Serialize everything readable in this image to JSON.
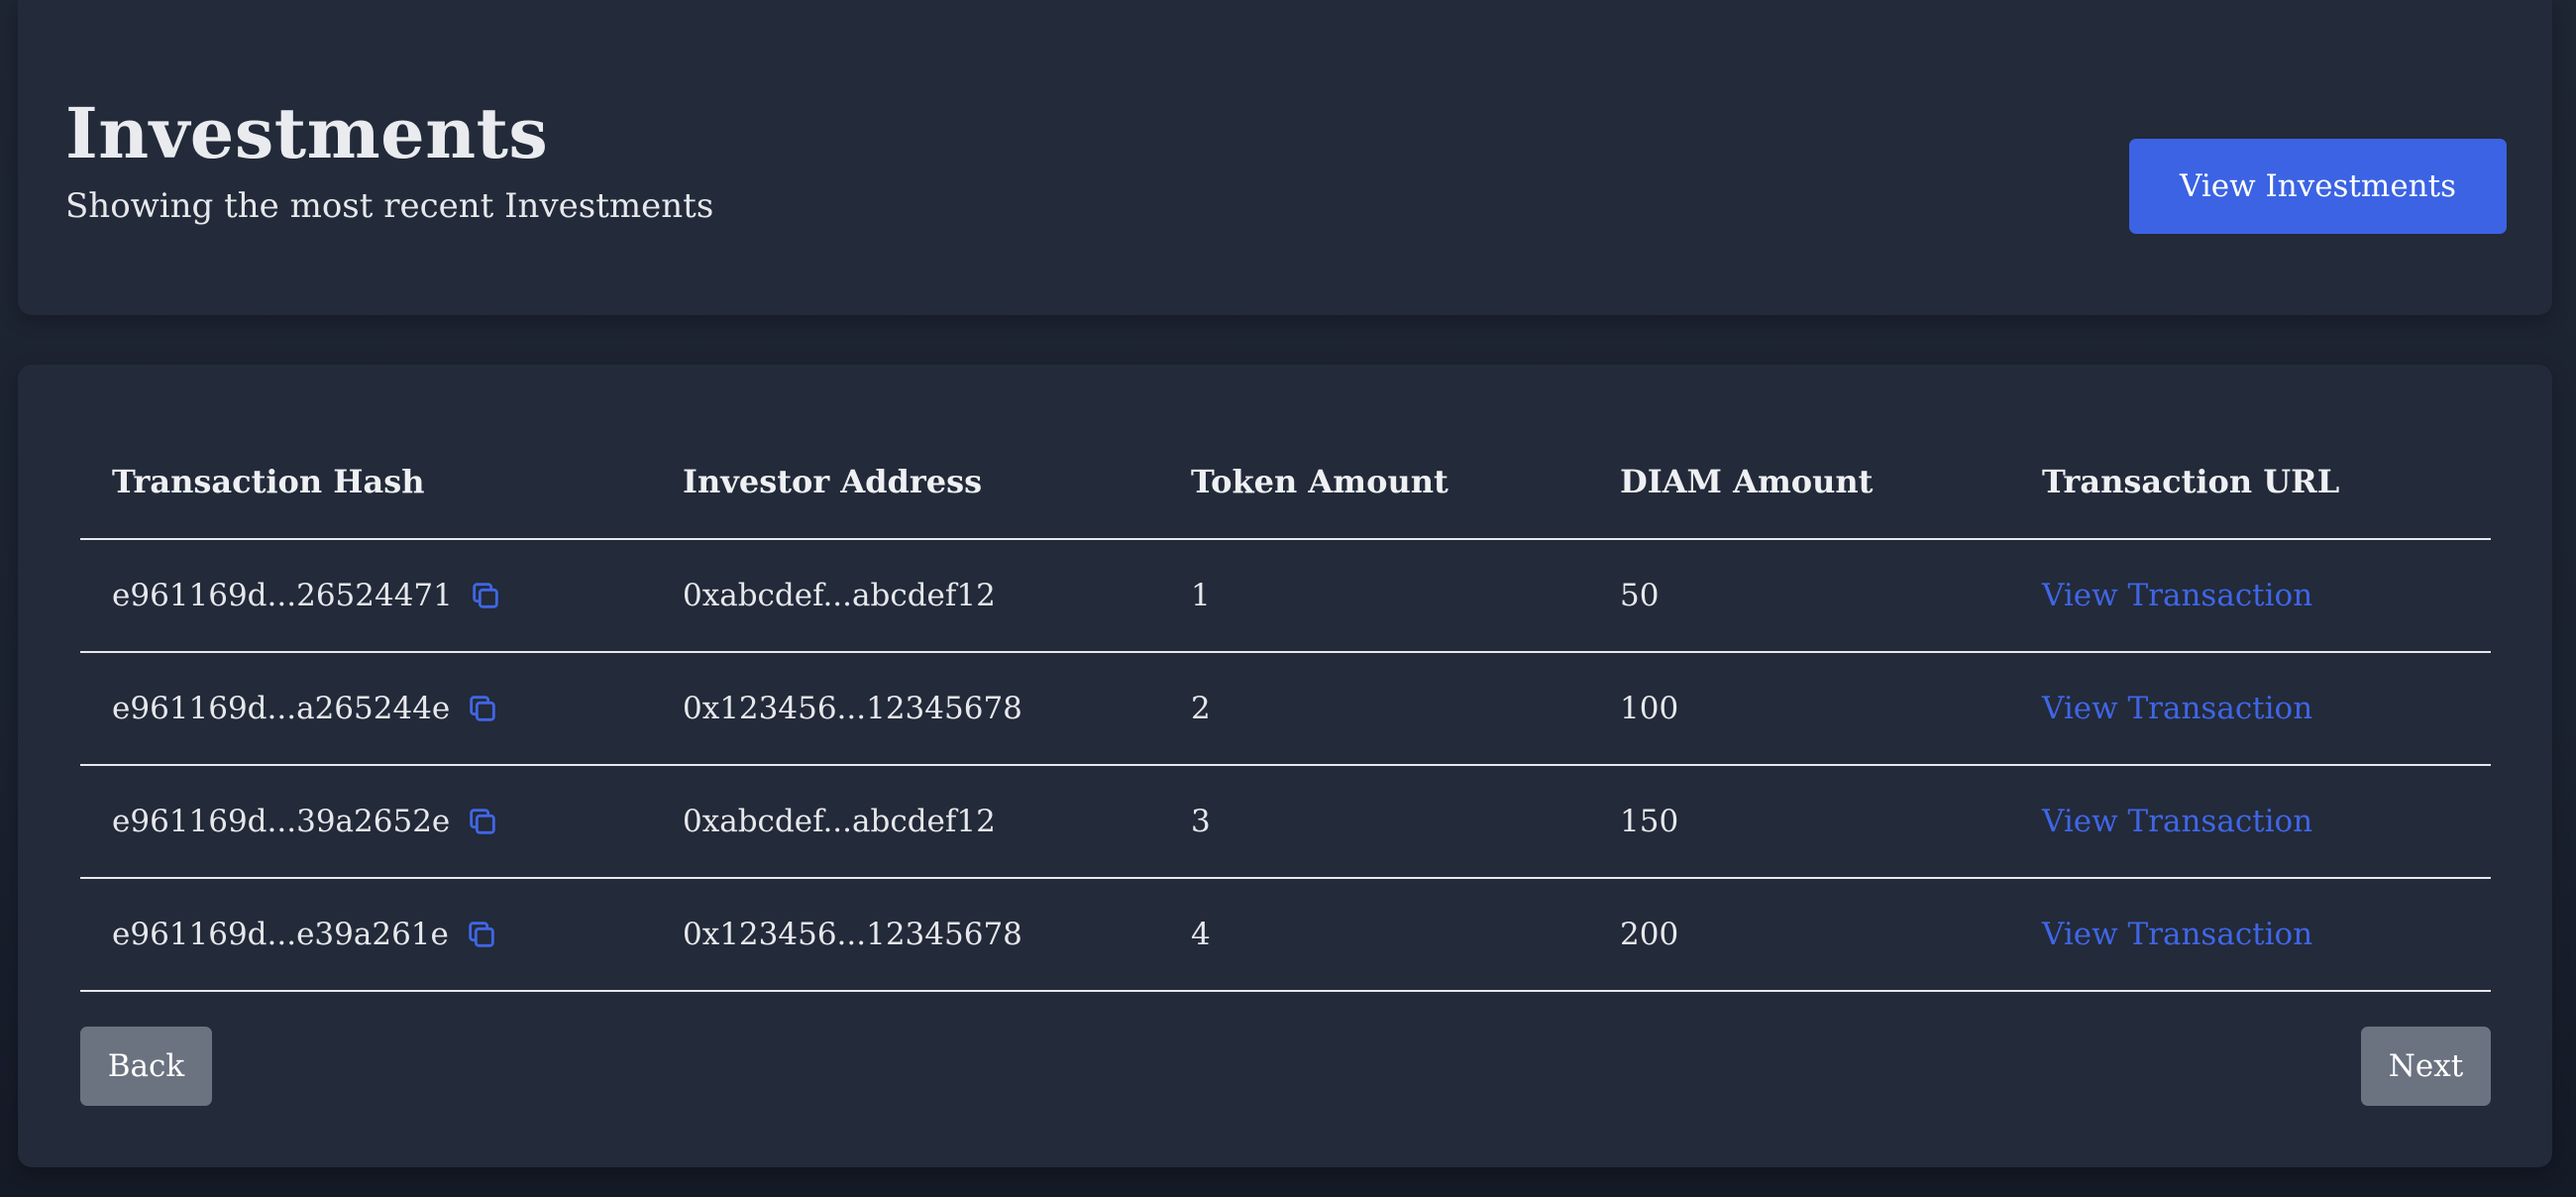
{
  "header": {
    "title": "Investments",
    "subtitle": "Showing the most recent Investments",
    "view_button_label": "View Investments"
  },
  "table": {
    "columns": [
      "Transaction Hash",
      "Investor Address",
      "Token Amount",
      "DIAM Amount",
      "Transaction URL"
    ],
    "rows": [
      {
        "hash": "e961169d...26524471",
        "address": "0xabcdef...abcdef12",
        "token_amount": "1",
        "diam_amount": "50",
        "url_label": "View Transaction"
      },
      {
        "hash": "e961169d...a265244e",
        "address": "0x123456...12345678",
        "token_amount": "2",
        "diam_amount": "100",
        "url_label": "View Transaction"
      },
      {
        "hash": "e961169d...39a2652e",
        "address": "0xabcdef...abcdef12",
        "token_amount": "3",
        "diam_amount": "150",
        "url_label": "View Transaction"
      },
      {
        "hash": "e961169d...e39a261e",
        "address": "0x123456...12345678",
        "token_amount": "4",
        "diam_amount": "200",
        "url_label": "View Transaction"
      }
    ]
  },
  "pagination": {
    "back_label": "Back",
    "next_label": "Next"
  },
  "icons": {
    "copy": "copy-icon"
  },
  "colors": {
    "accent": "#3b63e3",
    "link": "#3f66e6",
    "card_bg": "#232a39",
    "page_bg": "#1b2230",
    "pager_bg": "#6b7280"
  }
}
